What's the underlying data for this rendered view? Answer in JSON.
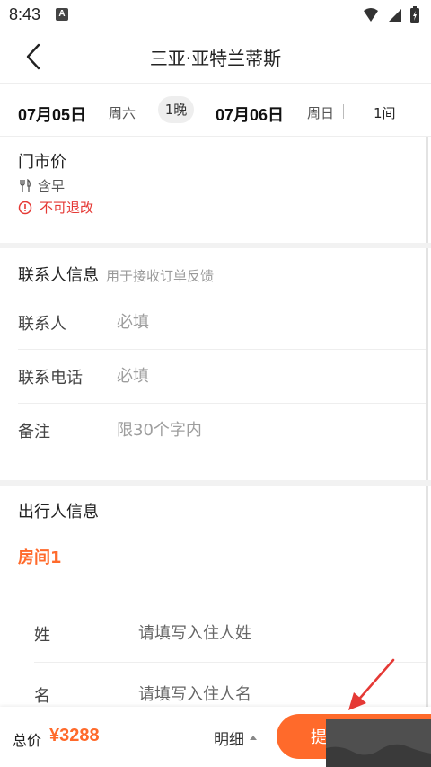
{
  "status_bar": {
    "time": "8:43",
    "notif_badge": "A"
  },
  "nav": {
    "title": "三亚·亚特兰蒂斯"
  },
  "dates": {
    "checkin_date": "07月05日",
    "checkin_weekday": "周六",
    "nights": "1晚",
    "checkout_date": "07月06日",
    "checkout_weekday": "周日",
    "rooms": "1间"
  },
  "room": {
    "price_type": "门市价",
    "meal": "含早",
    "refund_policy": "不可退改"
  },
  "contact": {
    "title": "联系人信息",
    "subtitle": "用于接收订单反馈",
    "name_label": "联系人",
    "name_placeholder": "必填",
    "phone_label": "联系电话",
    "phone_placeholder": "必填",
    "note_label": "备注",
    "note_placeholder": "限30个字内"
  },
  "traveler": {
    "title": "出行人信息",
    "room_label": "房间1",
    "surname_label": "姓",
    "surname_placeholder": "请填写入住人姓",
    "given_label": "名",
    "given_placeholder": "请填写入住人名"
  },
  "footer": {
    "total_label": "总价",
    "total_price": "¥3288",
    "detail_label": "明细",
    "submit_label": "提"
  },
  "colors": {
    "accent": "#ff6a2b",
    "warning": "#e53935",
    "annotation_arrow": "#e53935"
  }
}
